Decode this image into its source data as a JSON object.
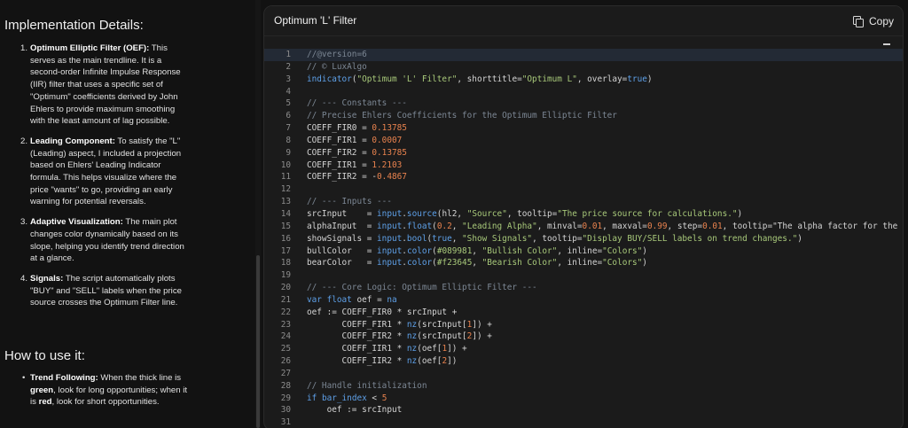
{
  "doc": {
    "impl_heading": "Implementation Details:",
    "items": [
      {
        "bold": "Optimum Elliptic Filter (OEF):",
        "text": " This serves as the main trendline. It is a second-order Infinite Impulse Response (IIR) filter that uses a specific set of \"Optimum\" coefficients derived by John Ehlers to provide maximum smoothing with the least amount of lag possible."
      },
      {
        "bold": "Leading Component:",
        "text": " To satisfy the \"L\" (Leading) aspect, I included a projection based on Ehlers' Leading Indicator formula. This helps visualize where the price \"wants\" to go, providing an early warning for potential reversals."
      },
      {
        "bold": "Adaptive Visualization:",
        "text": " The main plot changes color dynamically based on its slope, helping you identify trend direction at a glance."
      },
      {
        "bold": "Signals:",
        "text": " The script automatically plots \"BUY\" and \"SELL\" labels when the price source crosses the Optimum Filter line."
      }
    ],
    "howto_heading": "How to use it:",
    "howto": {
      "bold": "Trend Following:",
      "t1": " When the thick line is ",
      "green": "green",
      "t2": ", look for long opportunities; when it is ",
      "red": "red",
      "t3": ", look for short opportunities."
    }
  },
  "panel": {
    "title": "Optimum 'L' Filter",
    "copy_label": "Copy",
    "code": [
      "//@version=6",
      "// © LuxAlgo",
      "indicator(\"Optimum 'L' Filter\", shorttitle=\"Optimum L\", overlay=true)",
      "",
      "// --- Constants ---",
      "// Precise Ehlers Coefficients for the Optimum Elliptic Filter",
      "COEFF_FIR0 = 0.13785",
      "COEFF_FIR1 = 0.0007",
      "COEFF_FIR2 = 0.13785",
      "COEFF_IIR1 = 1.2103",
      "COEFF_IIR2 = -0.4867",
      "",
      "// --- Inputs ---",
      "srcInput    = input.source(hl2, \"Source\", tooltip=\"The price source for calculations.\")",
      "alphaInput  = input.float(0.2, \"Leading Alpha\", minval=0.01, maxval=0.99, step=0.01, tooltip=\"The alpha factor for the L",
      "showSignals = input.bool(true, \"Show Signals\", tooltip=\"Display BUY/SELL labels on trend changes.\")",
      "bullColor   = input.color(#089981, \"Bullish Color\", inline=\"Colors\")",
      "bearColor   = input.color(#f23645, \"Bearish Color\", inline=\"Colors\")",
      "",
      "// --- Core Logic: Optimum Elliptic Filter ---",
      "var float oef = na",
      "oef := COEFF_FIR0 * srcInput +",
      "       COEFF_FIR1 * nz(srcInput[1]) +",
      "       COEFF_FIR2 * nz(srcInput[2]) +",
      "       COEFF_IIR1 * nz(oef[1]) +",
      "       COEFF_IIR2 * nz(oef[2])",
      "",
      "// Handle initialization",
      "if bar_index < 5",
      "    oef := srcInput",
      ""
    ]
  }
}
